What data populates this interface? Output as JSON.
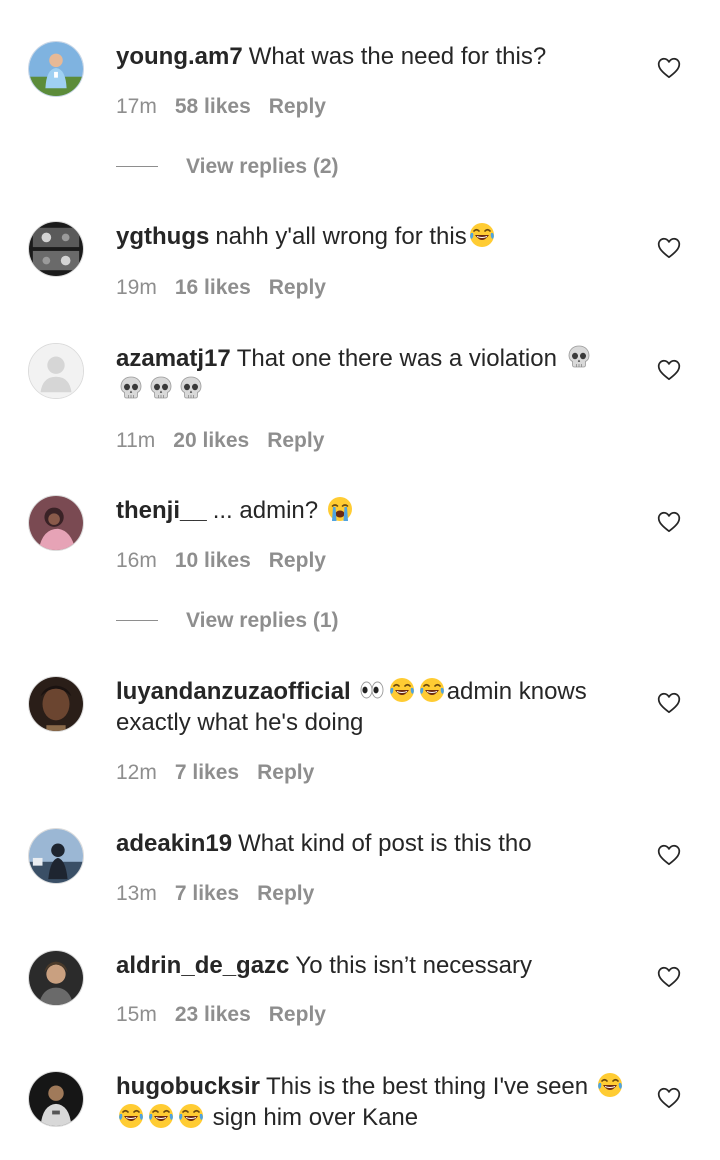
{
  "comments": [
    {
      "username": "young.am7",
      "text": "What was the need for this?",
      "emojis_after": [],
      "time": "17m",
      "likes": "58 likes",
      "reply": "Reply",
      "view_replies": "View replies (2)"
    },
    {
      "username": "ygthugs",
      "text": "nahh y'all wrong for this",
      "time": "19m",
      "likes": "16 likes",
      "reply": "Reply"
    },
    {
      "username": "azamatj17",
      "text": "That one there was a violation",
      "time": "11m",
      "likes": "20 likes",
      "reply": "Reply"
    },
    {
      "username": "thenji__",
      "text": "... admin?",
      "time": "16m",
      "likes": "10 likes",
      "reply": "Reply",
      "view_replies": "View replies (1)"
    },
    {
      "username": "luyandanzuzaofficial",
      "text_after_emojis": "admin knows",
      "text_line2": "exactly what he's doing",
      "time": "12m",
      "likes": "7 likes",
      "reply": "Reply"
    },
    {
      "username": "adeakin19",
      "text": "What kind of post is this tho",
      "time": "13m",
      "likes": "7 likes",
      "reply": "Reply"
    },
    {
      "username": "aldrin_de_gazc",
      "text": "Yo this isn’t necessary",
      "time": "15m",
      "likes": "23 likes",
      "reply": "Reply"
    },
    {
      "username": "hugobucksir",
      "text": "This is the best thing I've seen",
      "text_line2": "sign him over Kane",
      "time": "",
      "likes": "",
      "reply": ""
    }
  ],
  "icons": {
    "like": "heart-outline-icon",
    "laugh": "face-with-tears-of-joy-emoji",
    "skull": "skull-emoji",
    "cry": "loudly-crying-face-emoji",
    "eyes": "eyes-emoji"
  },
  "colors": {
    "text": "#262626",
    "secondary": "#8e8e8e",
    "background": "#ffffff"
  }
}
